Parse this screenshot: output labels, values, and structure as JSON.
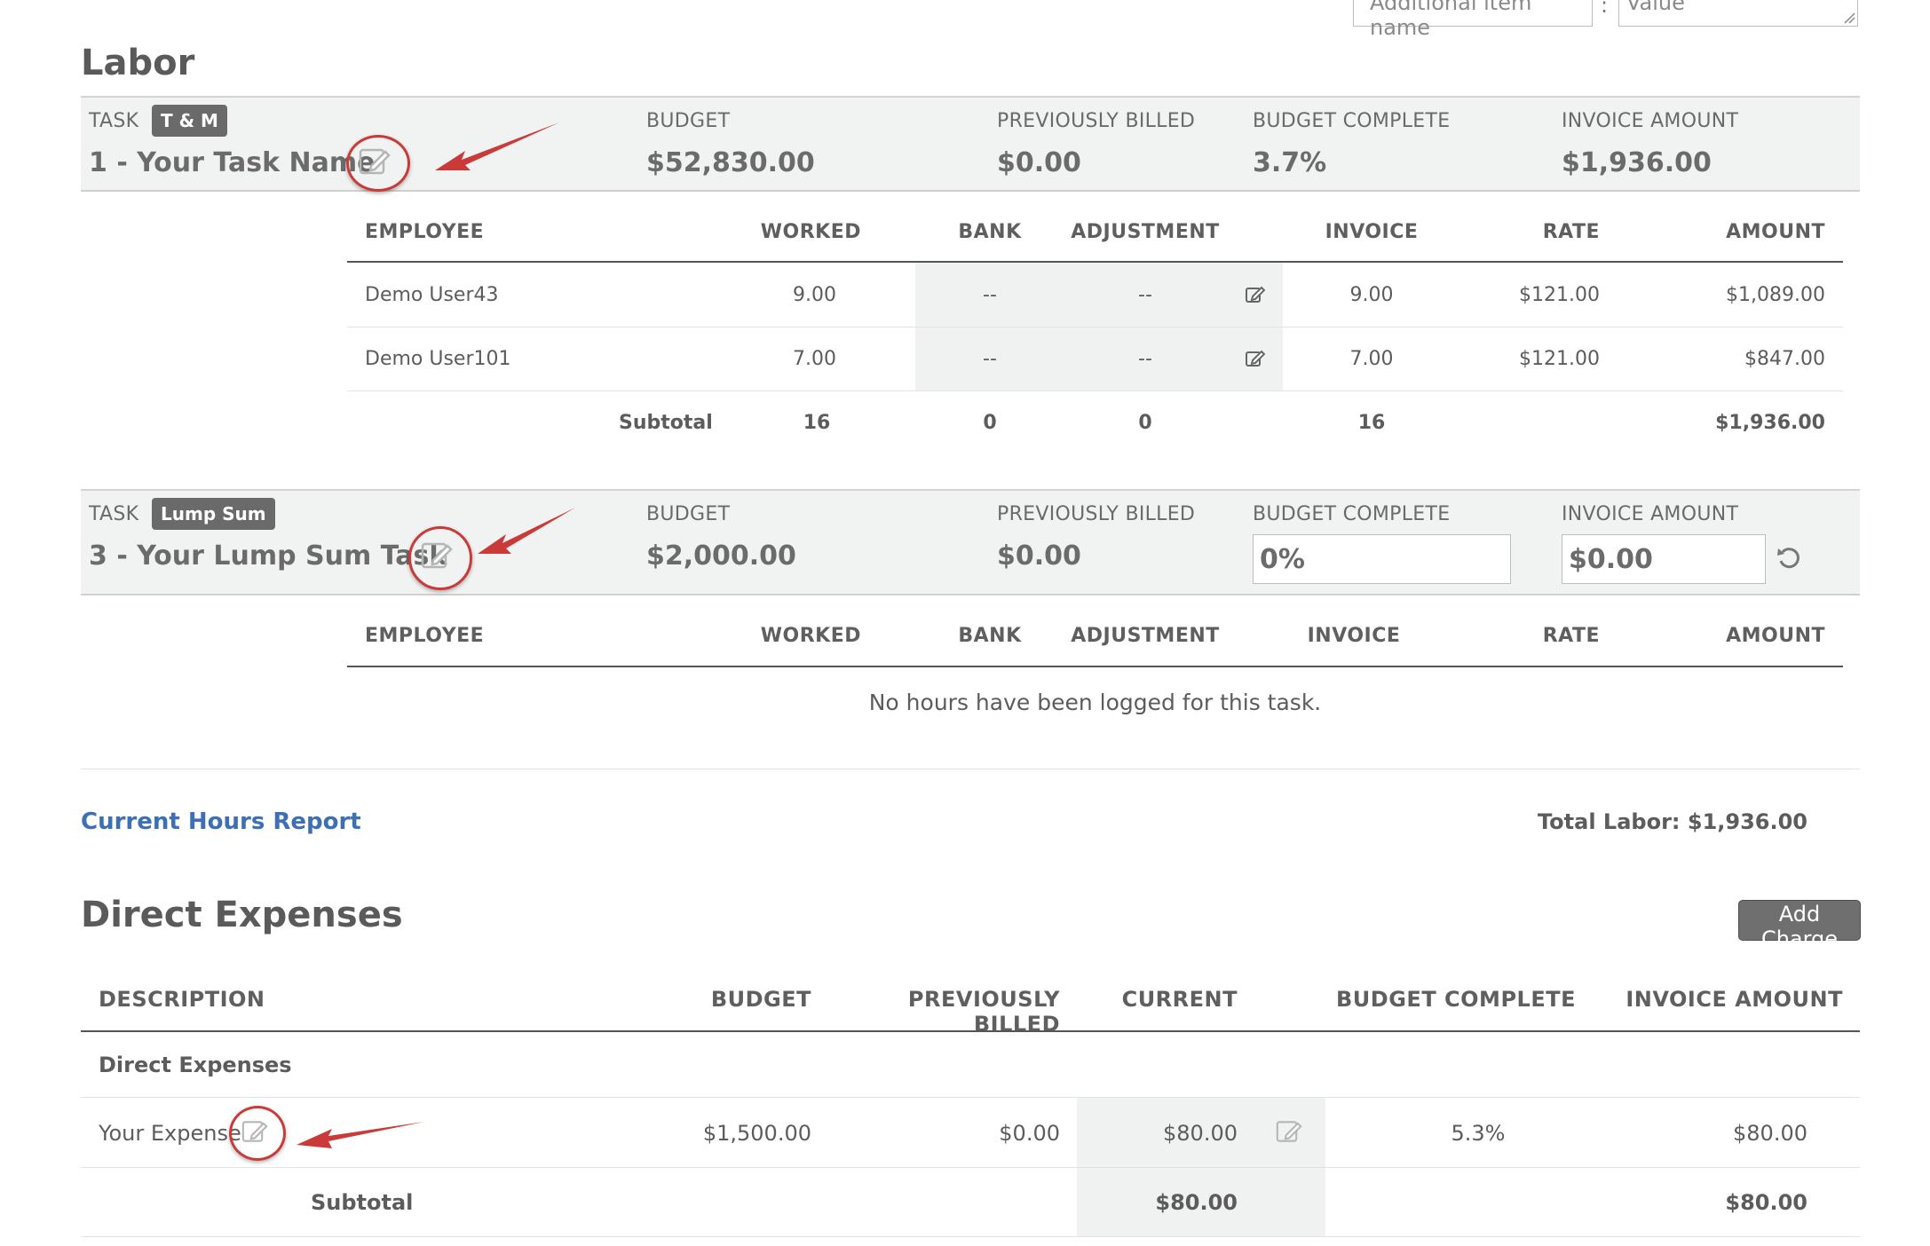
{
  "top_inputs": {
    "item_name_placeholder": "Additional item name",
    "separator": ":",
    "value_placeholder": "Value"
  },
  "labor": {
    "heading": "Labor",
    "task_label": "TASK",
    "budget_label": "BUDGET",
    "prev_billed_label": "PREVIOUSLY BILLED",
    "budget_complete_label": "BUDGET COMPLETE",
    "invoice_amount_label": "INVOICE AMOUNT",
    "tasks": [
      {
        "badge": "T & M",
        "name": "1 - Your Task Name",
        "budget": "$52,830.00",
        "prev_billed": "$0.00",
        "budget_complete": "3.7%",
        "invoice_amount": "$1,936.00",
        "columns": [
          "EMPLOYEE",
          "WORKED",
          "BANK",
          "ADJUSTMENT",
          "INVOICE",
          "RATE",
          "AMOUNT"
        ],
        "rows": [
          {
            "employee": "Demo User43",
            "worked": "9.00",
            "bank": "--",
            "adjustment": "--",
            "invoice": "9.00",
            "rate": "$121.00",
            "amount": "$1,089.00"
          },
          {
            "employee": "Demo User101",
            "worked": "7.00",
            "bank": "--",
            "adjustment": "--",
            "invoice": "7.00",
            "rate": "$121.00",
            "amount": "$847.00"
          }
        ],
        "subtotal": {
          "label": "Subtotal",
          "worked": "16",
          "bank": "0",
          "adjustment": "0",
          "invoice": "16",
          "amount": "$1,936.00"
        }
      },
      {
        "badge": "Lump Sum",
        "name": "3 - Your Lump Sum Task",
        "budget": "$2,000.00",
        "prev_billed": "$0.00",
        "budget_complete_input": "0%",
        "invoice_amount_input": "$0.00",
        "columns": [
          "EMPLOYEE",
          "WORKED",
          "BANK",
          "ADJUSTMENT",
          "INVOICE",
          "RATE",
          "AMOUNT"
        ],
        "empty_message": "No hours have been logged for this task."
      }
    ],
    "report_link": "Current Hours Report",
    "total": "Total Labor: $1,936.00"
  },
  "expenses": {
    "heading": "Direct Expenses",
    "add_button": "Add Charge",
    "columns": [
      "DESCRIPTION",
      "BUDGET",
      "PREVIOUSLY BILLED",
      "CURRENT",
      "BUDGET COMPLETE",
      "INVOICE AMOUNT"
    ],
    "group": "Direct Expenses",
    "rows": [
      {
        "description": "Your Expense",
        "budget": "$1,500.00",
        "prev_billed": "$0.00",
        "current": "$80.00",
        "budget_complete": "5.3%",
        "invoice_amount": "$80.00"
      }
    ],
    "subtotal": {
      "label": "Subtotal",
      "current": "$80.00",
      "invoice_amount": "$80.00"
    }
  },
  "colors": {
    "annotation_red": "#c93a38",
    "link_blue": "#3d6fb5",
    "badge_grey": "#6a6a6a"
  },
  "icons": [
    "edit-icon",
    "refresh-icon",
    "resize-handle-icon",
    "red-arrow-annotation"
  ]
}
